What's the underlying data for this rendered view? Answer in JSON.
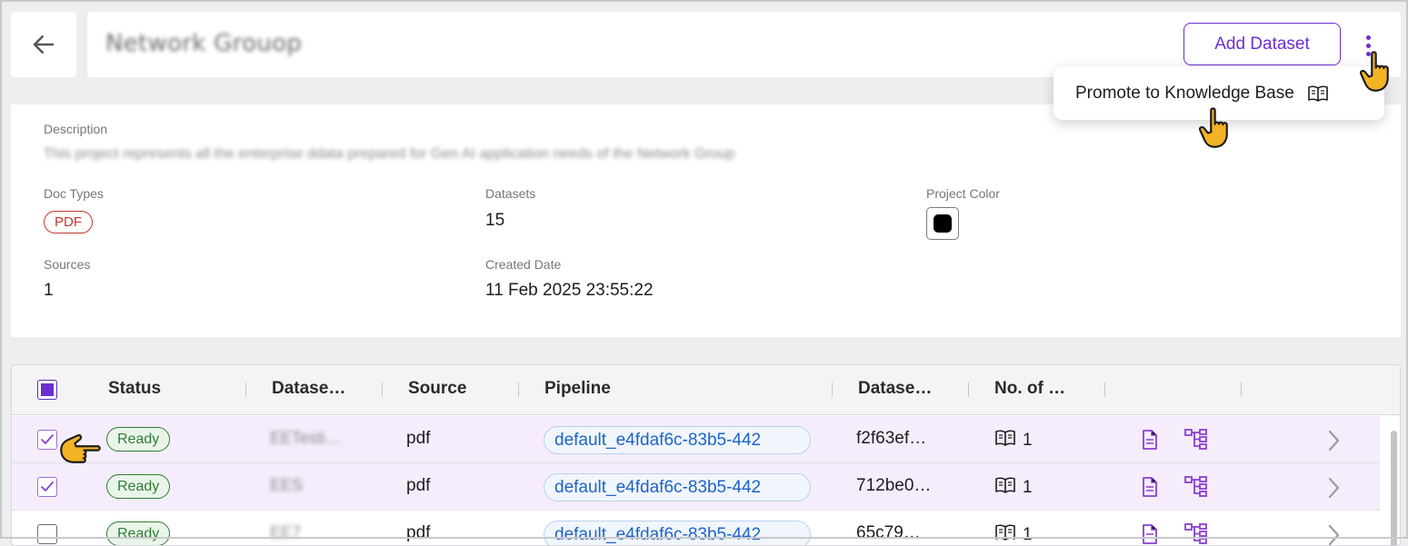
{
  "header": {
    "title": "Network Grouop",
    "add_dataset_label": "Add Dataset",
    "menu": {
      "promote_label": "Promote to Knowledge Base"
    }
  },
  "details": {
    "description_label": "Description",
    "description_value": "This project represents all the enterprise ddata prepared for Gen AI application needs of the Network Group",
    "doc_types_label": "Doc Types",
    "doc_type": "PDF",
    "datasets_label": "Datasets",
    "datasets_value": "15",
    "project_color_label": "Project Color",
    "project_color": "#000000",
    "sources_label": "Sources",
    "sources_value": "1",
    "created_date_label": "Created Date",
    "created_date_value": "11 Feb 2025 23:55:22"
  },
  "table": {
    "columns": [
      "Status",
      "Datase…",
      "Source",
      "Pipeline",
      "Datase…",
      "No. of …"
    ],
    "rows": [
      {
        "selected": true,
        "status": "Ready",
        "dataset_name": "EETesti…",
        "source": "pdf",
        "pipeline": "default_e4fdaf6c-83b5-442",
        "dataset_id": "f2f63ef…",
        "docs": "1"
      },
      {
        "selected": true,
        "status": "Ready",
        "dataset_name": "EES",
        "source": "pdf",
        "pipeline": "default_e4fdaf6c-83b5-442",
        "dataset_id": "712be0…",
        "docs": "1"
      },
      {
        "selected": false,
        "status": "Ready",
        "dataset_name": "EE7",
        "source": "pdf",
        "pipeline": "default_e4fdaf6c-83b5-442",
        "dataset_id": "65c79…",
        "docs": "1"
      }
    ]
  },
  "colors": {
    "accent": "#6d2fcf",
    "status_ready": "#2e7d32",
    "pdf_chip": "#c0392b",
    "pipeline_link": "#1e63c8",
    "selected_row": "#f5edfb"
  },
  "icons": [
    "arrow-left-icon",
    "kebab-menu-icon",
    "book-icon",
    "document-icon",
    "hierarchy-icon",
    "chevron-right-icon",
    "hand-pointer-icon"
  ]
}
